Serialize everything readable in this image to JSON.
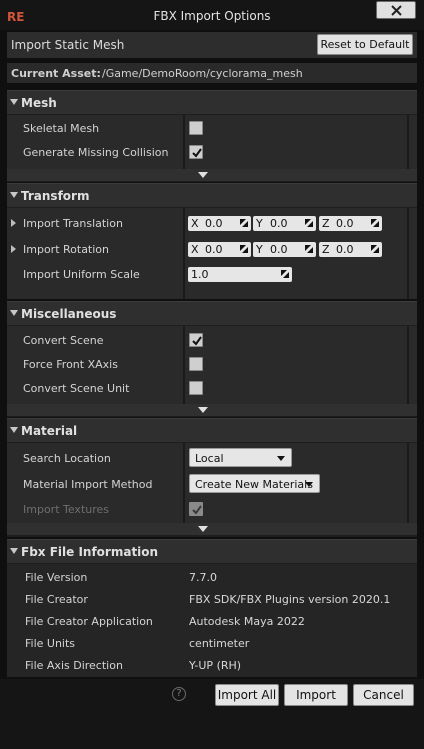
{
  "window": {
    "title": "FBX Import Options",
    "close_icon": "close-icon",
    "logo_text": "RE"
  },
  "header": {
    "import_label": "Import Static Mesh",
    "reset_button": "Reset to Default",
    "asset_label": "Current Asset:",
    "asset_path": "/Game/DemoRoom/cyclorama_mesh"
  },
  "mesh": {
    "title": "Mesh",
    "skeletal_mesh": {
      "label": "Skeletal Mesh",
      "checked": false
    },
    "generate_collision": {
      "label": "Generate Missing Collision",
      "checked": true
    }
  },
  "transform": {
    "title": "Transform",
    "translation": {
      "label": "Import Translation",
      "x": "0.0",
      "y": "0.0",
      "z": "0.0"
    },
    "rotation": {
      "label": "Import Rotation",
      "x": "0.0",
      "y": "0.0",
      "z": "0.0"
    },
    "scale": {
      "label": "Import Uniform Scale",
      "value": "1.0"
    },
    "axis_labels": {
      "x": "X",
      "y": "Y",
      "z": "Z"
    }
  },
  "misc": {
    "title": "Miscellaneous",
    "convert_scene": {
      "label": "Convert Scene",
      "checked": true
    },
    "force_front_xaxis": {
      "label": "Force Front XAxis",
      "checked": false
    },
    "convert_scene_unit": {
      "label": "Convert Scene Unit",
      "checked": false
    }
  },
  "material": {
    "title": "Material",
    "search_location": {
      "label": "Search Location",
      "value": "Local"
    },
    "import_method": {
      "label": "Material Import Method",
      "value": "Create New Materials"
    },
    "import_textures": {
      "label": "Import Textures",
      "checked": true,
      "enabled": false
    }
  },
  "fbx_info": {
    "title": "Fbx File Information",
    "rows": [
      {
        "label": "File Version",
        "value": "7.7.0"
      },
      {
        "label": "File Creator",
        "value": "FBX SDK/FBX Plugins version 2020.1"
      },
      {
        "label": "File Creator Application",
        "value": "Autodesk Maya 2022"
      },
      {
        "label": "File Units",
        "value": "centimeter"
      },
      {
        "label": "File Axis Direction",
        "value": "Y-UP (RH)"
      }
    ]
  },
  "footer": {
    "help_icon": "question-icon",
    "help_text": "?",
    "import_all": "Import All",
    "import": "Import",
    "cancel": "Cancel"
  }
}
